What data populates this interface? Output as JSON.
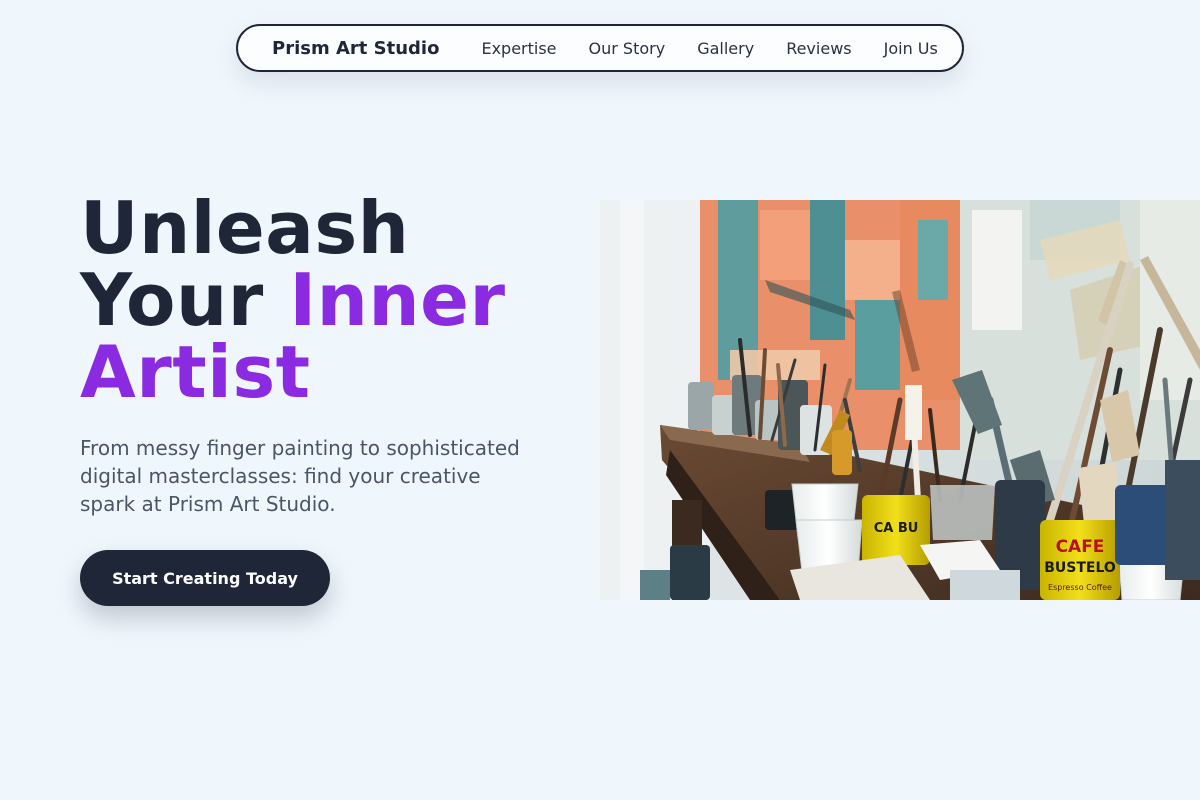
{
  "nav": {
    "brand": "Prism Art Studio",
    "links": [
      "Expertise",
      "Our Story",
      "Gallery",
      "Reviews",
      "Join Us"
    ]
  },
  "hero": {
    "title_line1": "Unleash",
    "title_line2a": "Your ",
    "title_line2b": "Inner",
    "title_line3": "Artist",
    "description": "From messy finger painting to sophisticated digital masterclasses: find your creative spark at Prism Art Studio.",
    "cta_label": "Start Creating Today"
  },
  "image": {
    "can_label_1": "CAFE",
    "can_label_2": "BUSTELO",
    "can_label_3": "Espresso Coffee",
    "side_label": "CA BU"
  },
  "colors": {
    "background": "#eff6fc",
    "dark": "#1e2638",
    "accent": "#8a2be2",
    "muted_text": "#4a5568"
  }
}
